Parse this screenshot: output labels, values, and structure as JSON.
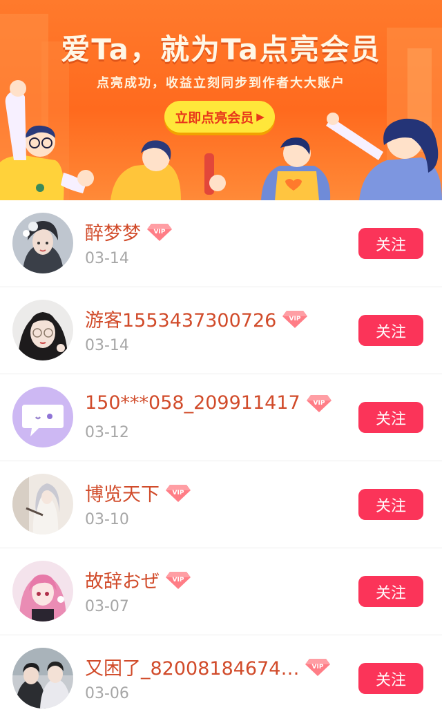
{
  "banner": {
    "title": "爱Ta，就为Ta点亮会员",
    "subtitle": "点亮成功，收益立刻同步到作者大大账户",
    "cta_label": "立即点亮会员"
  },
  "colors": {
    "banner_orange": "#ff7a2c",
    "cta_yellow": "#ffe73a",
    "username_red": "#d14b2a",
    "follow_button": "#fb3459",
    "date_gray": "#a6a6a6"
  },
  "vip_badge_text": "VIP",
  "follow_label": "关注",
  "users": [
    {
      "name": "醉梦梦",
      "date": "03-14",
      "avatar": "girl-illustration-avatar"
    },
    {
      "name": "游客1553437300726",
      "date": "03-14",
      "avatar": "girl-photo-avatar"
    },
    {
      "name": "150***058_209911417",
      "date": "03-12",
      "avatar": "chat-bubble-avatar"
    },
    {
      "name": "博览天下",
      "date": "03-10",
      "avatar": "anime-silver-hair-avatar"
    },
    {
      "name": "故辞おぜ",
      "date": "03-07",
      "avatar": "anime-pink-hair-avatar"
    },
    {
      "name": "又困了_82008184674…",
      "date": "03-06",
      "avatar": "couple-photo-avatar"
    }
  ]
}
